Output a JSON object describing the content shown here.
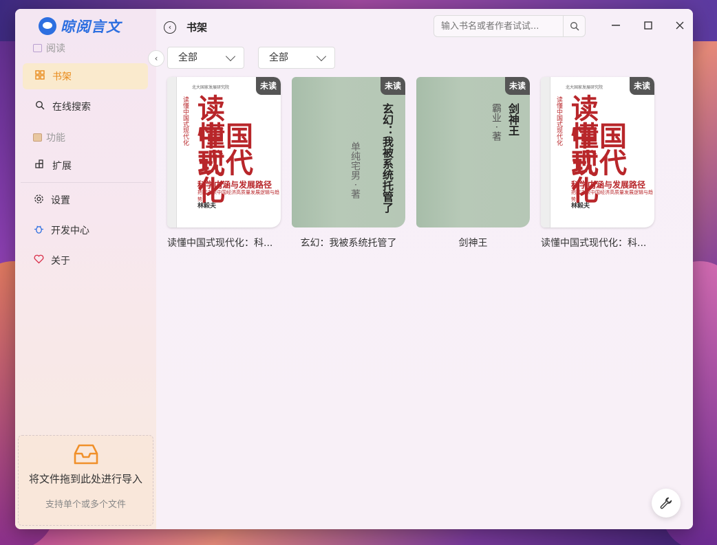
{
  "app": {
    "logo_text": "晾阅言文"
  },
  "sidebar": {
    "section_read": "阅读",
    "items_read": [
      {
        "label": "书架",
        "active": true
      },
      {
        "label": "在线搜索",
        "active": false
      }
    ],
    "section_func": "功能",
    "items_func": [
      {
        "label": "扩展"
      }
    ],
    "bottom_items": [
      {
        "label": "设置"
      },
      {
        "label": "开发中心"
      },
      {
        "label": "关于"
      }
    ],
    "drop_title": "将文件拖到此处进行导入",
    "drop_sub": "支持单个或多个文件"
  },
  "header": {
    "title": "书架",
    "search_placeholder": "输入书名或者作者试试..."
  },
  "filters": [
    {
      "value": "全部"
    },
    {
      "value": "全部"
    }
  ],
  "books": [
    {
      "name": "读懂中国式现代化：科...",
      "badge": "未读",
      "cover": {
        "line1": "读　懂",
        "line2": "中国式",
        "line3": "现代化",
        "subtitle": "科学内涵与发展路径",
        "subline": "把握未来中国经济高质量发展逻辑与趋势",
        "author": "林毅夫",
        "vertical": "读懂中国式现代化",
        "top": "北大国家发展研究院"
      }
    },
    {
      "name": "玄幻：我被系统托管了",
      "badge": "未读",
      "cover": {
        "title": "玄幻：我被系统托管了",
        "author": "单纯宅男 · 著"
      }
    },
    {
      "name": "剑神王",
      "badge": "未读",
      "cover": {
        "title": "剑神王",
        "author": "霸业 · 著"
      }
    },
    {
      "name": "读懂中国式现代化：科...",
      "badge": "未读",
      "cover": {
        "line1": "读　懂",
        "line2": "中国式",
        "line3": "现代化",
        "subtitle": "科学内涵与发展路径",
        "subline": "把握未来中国经济高质量发展逻辑与趋势",
        "author": "林毅夫",
        "vertical": "读懂中国式现代化",
        "top": "北大国家发展研究院"
      }
    }
  ],
  "colors": {
    "accent": "#e88a1a",
    "active_bg": "#faeacd",
    "brand": "#2d6fe0"
  }
}
